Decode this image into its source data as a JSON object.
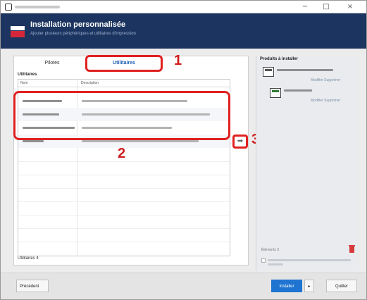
{
  "window": {
    "close_glyph": "×",
    "minimize_glyph": "−",
    "maximize_glyph": "□"
  },
  "header": {
    "title": "Installation personnalisée",
    "subtitle": "Ajouter plusieurs périphériques et utilitaires d'impression"
  },
  "tabs": [
    {
      "label": "Pilotes",
      "selected": false
    },
    {
      "label": "Utilitaires",
      "selected": true
    }
  ],
  "utilities": {
    "section_label": "Utilitaires",
    "columns": [
      "Nom",
      "Description"
    ],
    "count_label": "Utilitaires 4"
  },
  "callouts": {
    "one": "1",
    "two": "2",
    "three": "3"
  },
  "add_button_glyph": "➡",
  "products": {
    "title": "Produits à installer",
    "items": [
      {
        "icon": "printer-icon",
        "actions": "Modifier  Supprimer"
      },
      {
        "icon": "printer-app-icon",
        "actions": "Modifier  Supprimer"
      }
    ],
    "elements_label": "Éléments 3"
  },
  "footer": {
    "previous": "Précédent",
    "install": "Installer",
    "install_arrow": "▸",
    "quit": "Quitter"
  },
  "colors": {
    "header_bg": "#1c3560",
    "accent_red": "#e02020",
    "install_blue": "#1f74d1",
    "tab_blue": "#1a5fb4"
  }
}
